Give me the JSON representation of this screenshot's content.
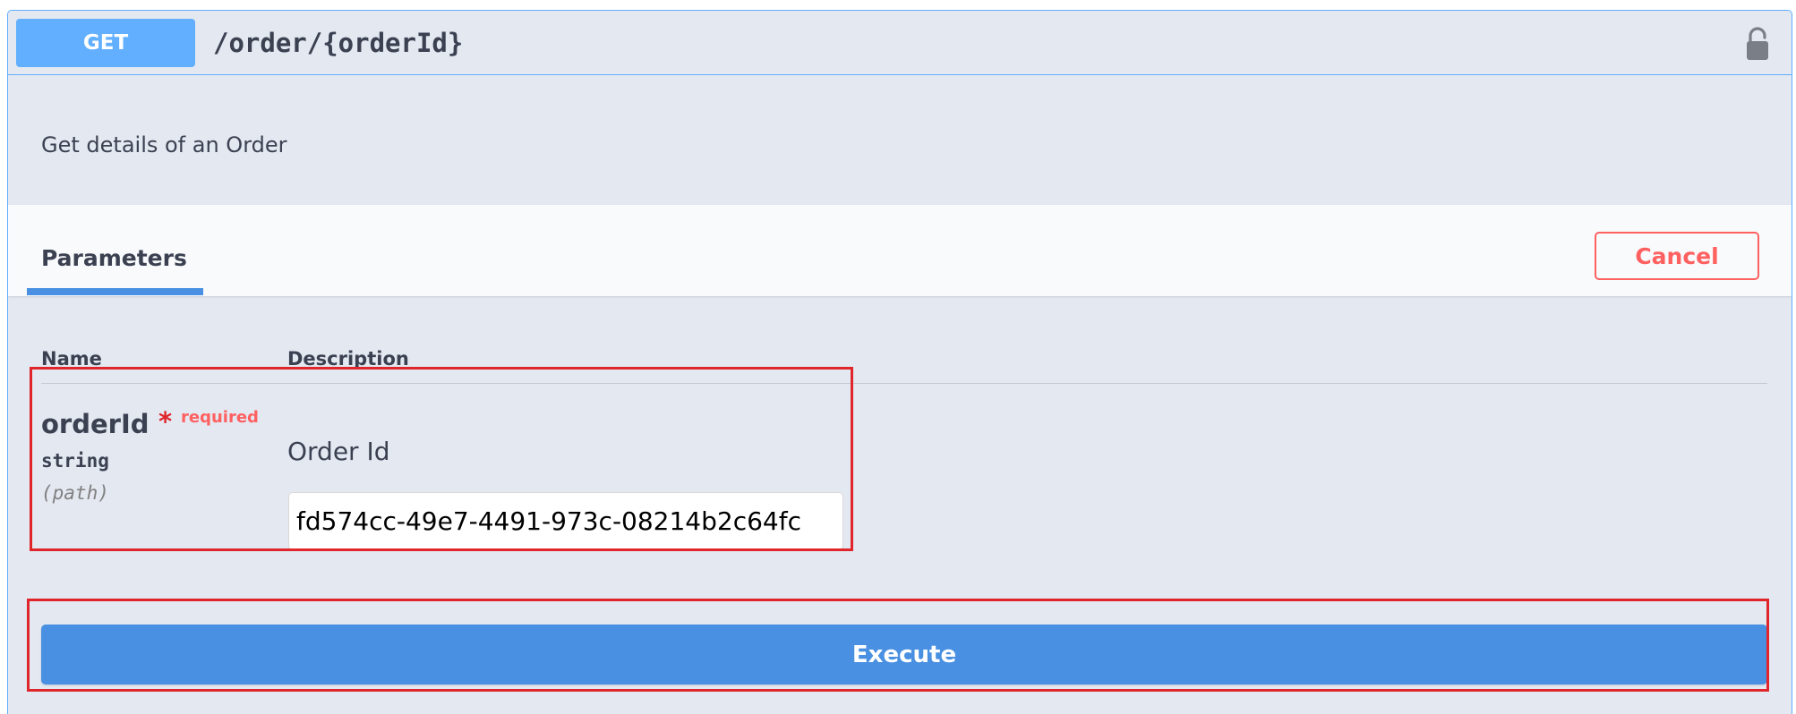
{
  "operation": {
    "method": "GET",
    "path": "/order/{orderId}",
    "description": "Get details of an Order",
    "method_color": "#61affe"
  },
  "tabs": {
    "parameters_label": "Parameters",
    "cancel_label": "Cancel"
  },
  "table": {
    "name_header": "Name",
    "description_header": "Description"
  },
  "parameter": {
    "name": "orderId",
    "required_star": "*",
    "required_label": "required",
    "type": "string",
    "location": "(path)",
    "description": "Order Id",
    "value": "fd574cc-49e7-4491-973c-08214b2c64fc"
  },
  "actions": {
    "execute_label": "Execute",
    "execute_color": "#4990e2",
    "cancel_color": "#ff6060"
  },
  "icons": {
    "lock": "lock-icon"
  }
}
